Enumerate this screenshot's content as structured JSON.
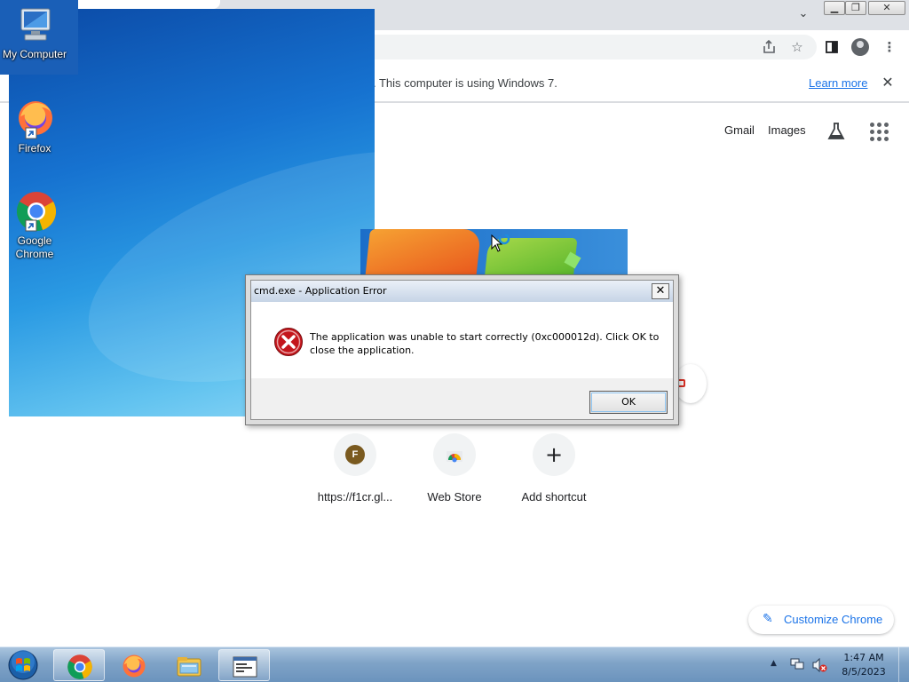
{
  "chrome": {
    "infobar_text": ". This computer is using Windows 7.",
    "learn_more": "Learn more",
    "gmail": "Gmail",
    "images": "Images",
    "shortcuts": [
      {
        "label": "https://f1cr.gl...",
        "badge": "F"
      },
      {
        "label": "Web Store"
      },
      {
        "label": "Add shortcut"
      }
    ],
    "customize": "Customize Chrome"
  },
  "desktop": {
    "icons": [
      {
        "label": "My Computer",
        "icon": "computer-icon"
      },
      {
        "label": "Firefox",
        "icon": "firefox-icon"
      },
      {
        "label": "Google Chrome",
        "icon": "chrome-icon"
      }
    ]
  },
  "dialog": {
    "title": "cmd.exe - Application Error",
    "message": "The application was unable to start correctly (0xc000012d). Click OK to close the application.",
    "ok_label": "OK",
    "close_glyph": "✕",
    "icon": "error-icon"
  },
  "taskbar": {
    "items": [
      "chrome-icon",
      "firefox-icon",
      "explorer-icon",
      "cmd-icon"
    ],
    "time": "1:47 AM",
    "date": "8/5/2023"
  },
  "colors": {
    "accent": "#1a73e8",
    "taskbar": "#7fa3c7",
    "error": "#c4161c"
  }
}
